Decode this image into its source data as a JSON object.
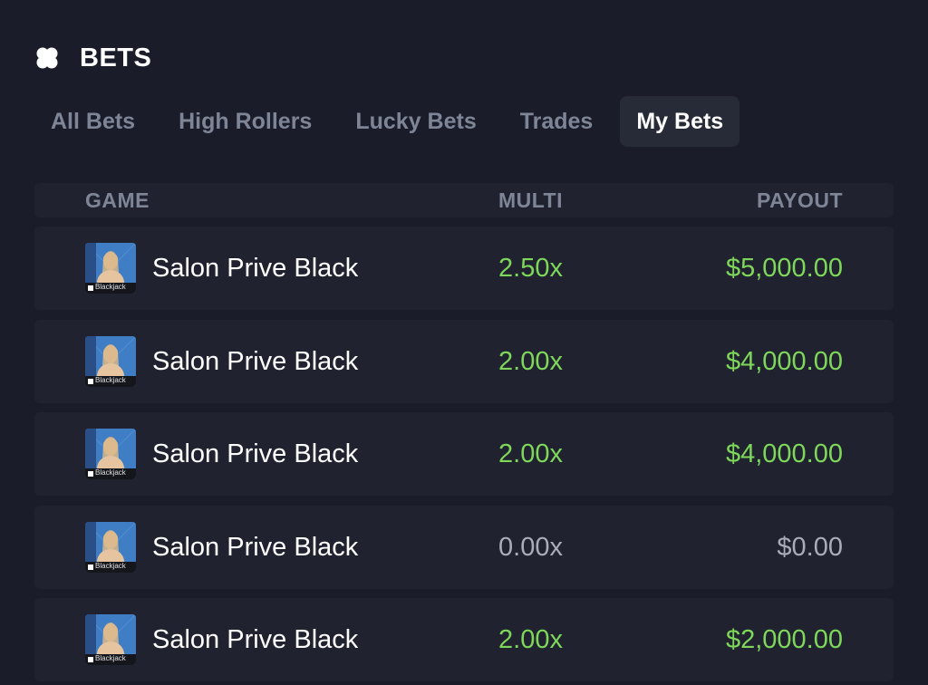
{
  "header": {
    "title": "BETS",
    "icon": "clover-icon"
  },
  "tabs": [
    {
      "label": "All Bets",
      "active": false
    },
    {
      "label": "High Rollers",
      "active": false
    },
    {
      "label": "Lucky Bets",
      "active": false
    },
    {
      "label": "Trades",
      "active": false
    },
    {
      "label": "My Bets",
      "active": true
    }
  ],
  "table": {
    "columns": {
      "game": "GAME",
      "multi": "MULTI",
      "payout": "PAYOUT"
    },
    "thumb_text": "Blackjack",
    "rows": [
      {
        "game": "Salon Prive Black",
        "multi": "2.50x",
        "payout": "$5,000.00",
        "win": true
      },
      {
        "game": "Salon Prive Black",
        "multi": "2.00x",
        "payout": "$4,000.00",
        "win": true
      },
      {
        "game": "Salon Prive Black",
        "multi": "2.00x",
        "payout": "$4,000.00",
        "win": true
      },
      {
        "game": "Salon Prive Black",
        "multi": "0.00x",
        "payout": "$0.00",
        "win": false
      },
      {
        "game": "Salon Prive Black",
        "multi": "2.00x",
        "payout": "$2,000.00",
        "win": true
      }
    ]
  },
  "colors": {
    "background": "#1a1d29",
    "win": "#7ed75a",
    "loss": "#a9adb8",
    "muted": "#7e8596"
  }
}
